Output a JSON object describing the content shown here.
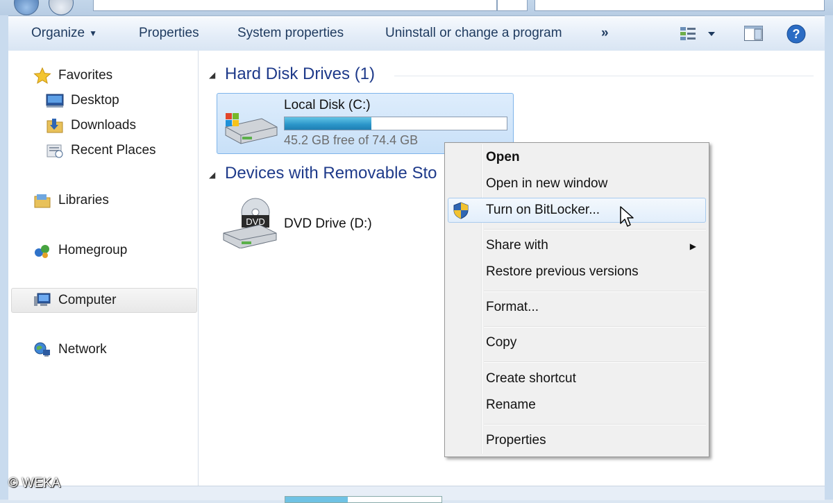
{
  "toolbar": {
    "organize": "Organize",
    "properties": "Properties",
    "system_properties": "System properties",
    "uninstall": "Uninstall or change a program",
    "more": "»"
  },
  "nav": {
    "favorites": "Favorites",
    "desktop": "Desktop",
    "downloads": "Downloads",
    "recent_places": "Recent Places",
    "libraries": "Libraries",
    "homegroup": "Homegroup",
    "computer": "Computer",
    "network": "Network"
  },
  "content": {
    "hdd_header": "Hard Disk Drives (1)",
    "removable_header": "Devices with Removable Sto",
    "local_disk": {
      "name": "Local Disk (C:)",
      "free_text": "45.2 GB free of 74.4 GB",
      "used_fraction": 0.39
    },
    "dvd": {
      "name": "DVD Drive (D:)",
      "icon_text": "DVD"
    }
  },
  "context_menu": {
    "open": "Open",
    "open_new_window": "Open in new window",
    "bitlocker": "Turn on BitLocker...",
    "share_with": "Share with",
    "restore": "Restore previous versions",
    "format": "Format...",
    "copy": "Copy",
    "create_shortcut": "Create shortcut",
    "rename": "Rename",
    "properties": "Properties"
  },
  "watermark": "© WEKA",
  "colors": {
    "accent": "#1e3a8a",
    "selection": "#c8e0f8",
    "usage_fill": "#2a94c8"
  }
}
